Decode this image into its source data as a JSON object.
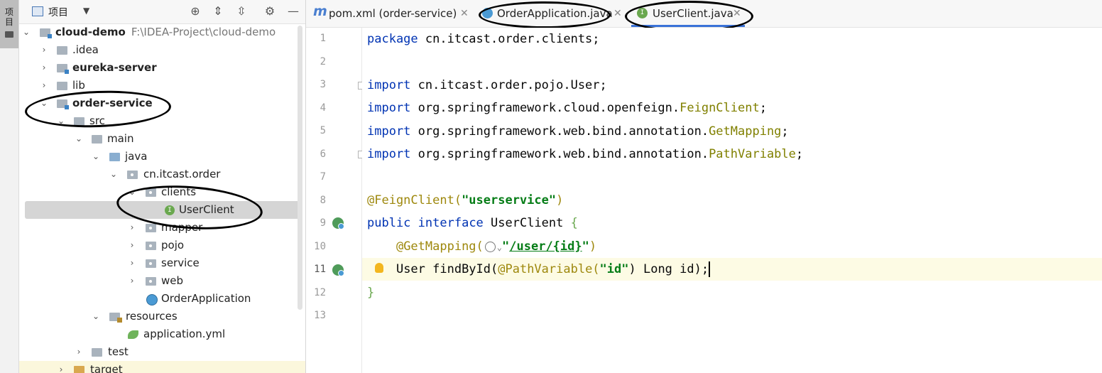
{
  "sidebar_strip": {
    "label": "项目"
  },
  "project_panel": {
    "title": "项目",
    "buttons": {
      "locate": "⊕",
      "expand": "⇕",
      "collapse": "⇳",
      "settings": "⚙",
      "hide": "—"
    },
    "tree": [
      {
        "label": "cloud-demo",
        "path": "F:\\IDEA-Project\\cloud-demo"
      },
      {
        "label": ".idea"
      },
      {
        "label": "eureka-server"
      },
      {
        "label": "lib"
      },
      {
        "label": "order-service"
      },
      {
        "label": "src"
      },
      {
        "label": "main"
      },
      {
        "label": "java"
      },
      {
        "label": "cn.itcast.order"
      },
      {
        "label": "clients"
      },
      {
        "label": "UserClient"
      },
      {
        "label": "mapper"
      },
      {
        "label": "pojo"
      },
      {
        "label": "service"
      },
      {
        "label": "web"
      },
      {
        "label": "OrderApplication"
      },
      {
        "label": "resources"
      },
      {
        "label": "application.yml"
      },
      {
        "label": "test"
      },
      {
        "label": "target"
      }
    ]
  },
  "editor_tabs": [
    {
      "label": "pom.xml (order-service)",
      "icon": "maven-icon"
    },
    {
      "label": "OrderApplication.java",
      "icon": "spring-class-icon"
    },
    {
      "label": "UserClient.java",
      "icon": "interface-icon",
      "active": true
    }
  ],
  "line_numbers": [
    "1",
    "2",
    "3",
    "4",
    "5",
    "6",
    "7",
    "8",
    "9",
    "10",
    "11",
    "12",
    "13"
  ],
  "code": {
    "l1": {
      "kw": "package",
      "rest": " cn.itcast.order.clients;"
    },
    "l3": {
      "kw": "import",
      "rest": " cn.itcast.order.pojo.User;"
    },
    "l4": {
      "kw": "import",
      "pre": " org.springframework.cloud.openfeign.",
      "ty": "FeignClient",
      "end": ";"
    },
    "l5": {
      "kw": "import",
      "pre": " org.springframework.web.bind.annotation.",
      "ty": "GetMapping",
      "end": ";"
    },
    "l6": {
      "kw": "import",
      "pre": " org.springframework.web.bind.annotation.",
      "ty": "PathVariable",
      "end": ";"
    },
    "l8": {
      "an": "@FeignClient(",
      "str": "\"userservice\"",
      "end": ")"
    },
    "l9": {
      "kw1": "public",
      "kw2": "interface",
      "name": " UserClient ",
      "brace": "{"
    },
    "l10": {
      "an": "@GetMapping(",
      "q1": "\"",
      "link": "/user/{id}",
      "q2": "\"",
      "end": ")"
    },
    "l11": {
      "a": "User findById(",
      "an": "@PathVariable(",
      "str": "\"id\"",
      "b": ") Long id);"
    },
    "l12": {
      "brace": "}"
    }
  },
  "colors": {
    "keyword": "#0033b3",
    "string": "#067d17",
    "annotation": "#9e880d",
    "active_tab_underline": "#3a72d8"
  }
}
